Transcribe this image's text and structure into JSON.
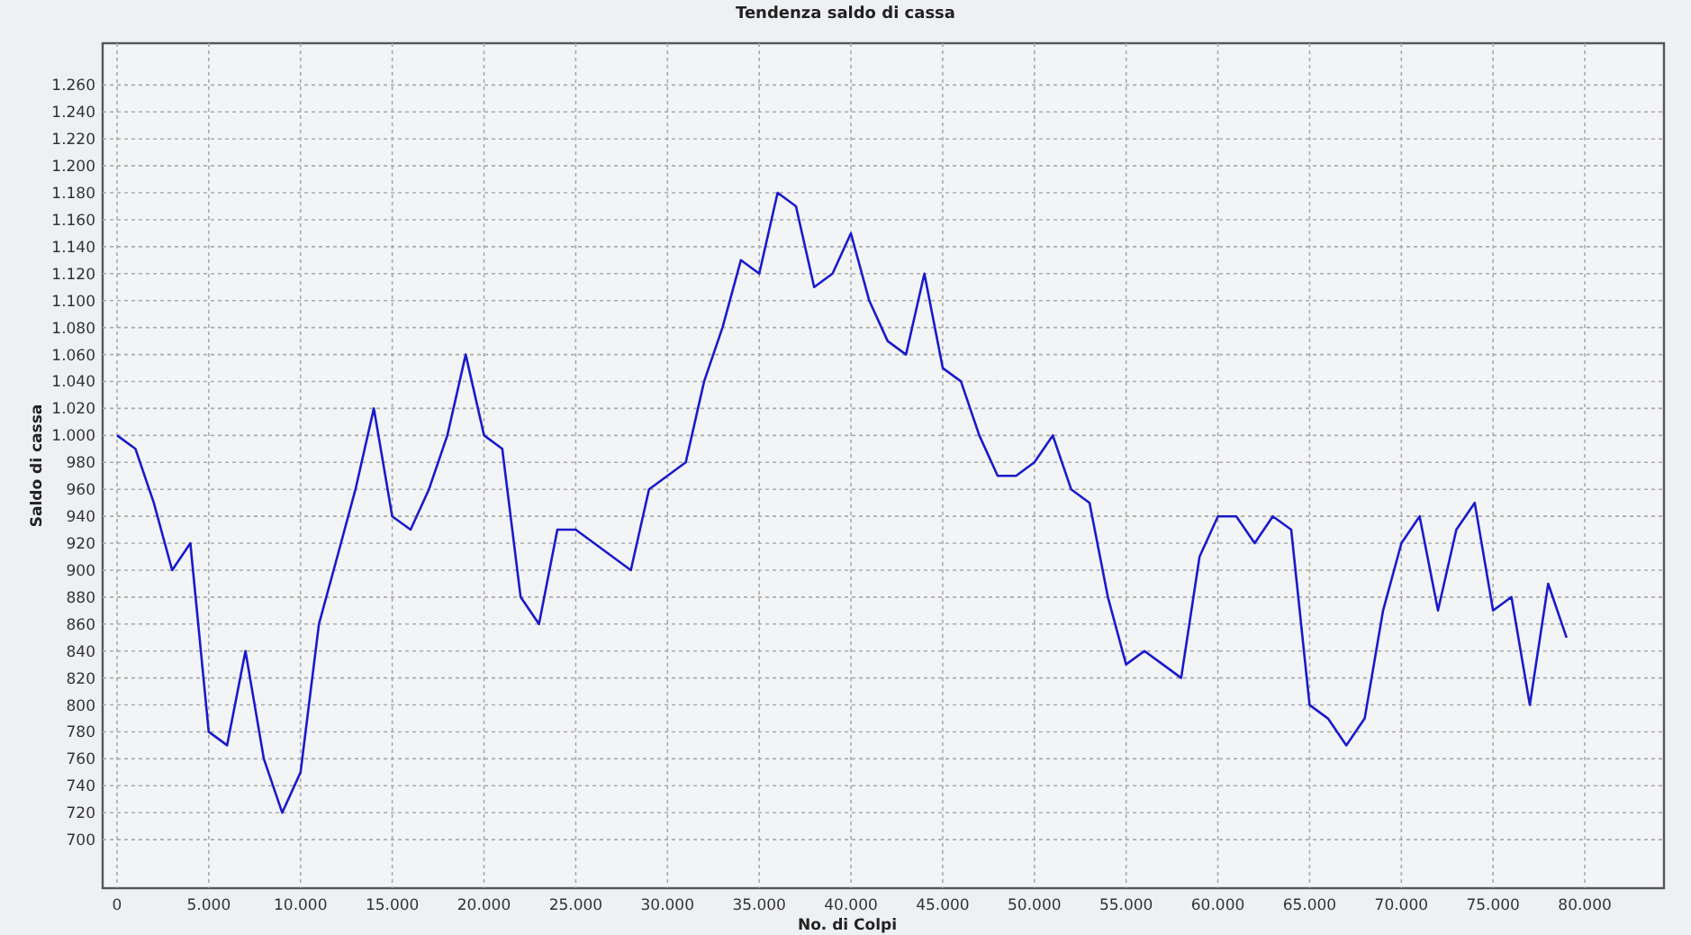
{
  "chart_data": {
    "type": "line",
    "title": "Tendenza saldo di cassa",
    "xlabel": "No. di Colpi",
    "ylabel": "Saldo di cassa",
    "x": [
      0,
      1000,
      2000,
      3000,
      4000,
      5000,
      6000,
      7000,
      8000,
      9000,
      10000,
      11000,
      12000,
      13000,
      14000,
      15000,
      16000,
      17000,
      18000,
      19000,
      20000,
      21000,
      22000,
      23000,
      24000,
      25000,
      26000,
      27000,
      28000,
      29000,
      30000,
      31000,
      32000,
      33000,
      34000,
      35000,
      36000,
      37000,
      38000,
      39000,
      40000,
      41000,
      42000,
      43000,
      44000,
      45000,
      46000,
      47000,
      48000,
      49000,
      50000,
      51000,
      52000,
      53000,
      54000,
      55000,
      56000,
      57000,
      58000,
      59000,
      60000,
      61000,
      62000,
      63000,
      64000,
      65000,
      66000,
      67000,
      68000,
      69000,
      70000,
      71000,
      72000,
      73000,
      74000,
      75000,
      76000,
      77000,
      78000,
      79000
    ],
    "series": [
      {
        "color": "#1a1acc",
        "values": [
          1000,
          990,
          950,
          900,
          920,
          780,
          770,
          840,
          760,
          720,
          750,
          860,
          910,
          960,
          1020,
          940,
          930,
          960,
          1000,
          1060,
          1000,
          990,
          880,
          860,
          930,
          930,
          920,
          910,
          900,
          960,
          970,
          980,
          1040,
          1080,
          1130,
          1120,
          1180,
          1170,
          1110,
          1120,
          1150,
          1100,
          1070,
          1060,
          1120,
          1050,
          1040,
          1000,
          970,
          970,
          980,
          1000,
          960,
          950,
          880,
          830,
          840,
          830,
          820,
          910,
          940,
          940,
          920,
          940,
          930,
          800,
          790,
          770,
          790,
          870,
          920,
          940,
          870,
          930,
          950,
          870,
          880,
          800,
          890,
          850
        ]
      }
    ],
    "xlim": [
      -785,
      84315
    ],
    "ylim": [
      664,
      1291
    ],
    "grid": true,
    "xticks": [
      {
        "value": 0,
        "label": "0"
      },
      {
        "value": 5000,
        "label": "5.000"
      },
      {
        "value": 10000,
        "label": "10.000"
      },
      {
        "value": 15000,
        "label": "15.000"
      },
      {
        "value": 20000,
        "label": "20.000"
      },
      {
        "value": 25000,
        "label": "25.000"
      },
      {
        "value": 30000,
        "label": "30.000"
      },
      {
        "value": 35000,
        "label": "35.000"
      },
      {
        "value": 40000,
        "label": "40.000"
      },
      {
        "value": 45000,
        "label": "45.000"
      },
      {
        "value": 50000,
        "label": "50.000"
      },
      {
        "value": 55000,
        "label": "55.000"
      },
      {
        "value": 60000,
        "label": "60.000"
      },
      {
        "value": 65000,
        "label": "65.000"
      },
      {
        "value": 70000,
        "label": "70.000"
      },
      {
        "value": 75000,
        "label": "75.000"
      },
      {
        "value": 80000,
        "label": "80.000"
      }
    ],
    "yticks": [
      700,
      720,
      740,
      760,
      780,
      800,
      820,
      840,
      860,
      880,
      900,
      920,
      940,
      960,
      980,
      {
        "value": 1000,
        "label": "1.000"
      },
      {
        "value": 1020,
        "label": "1.020"
      },
      {
        "value": 1040,
        "label": "1.040"
      },
      {
        "value": 1060,
        "label": "1.060"
      },
      {
        "value": 1080,
        "label": "1.080"
      },
      {
        "value": 1100,
        "label": "1.100"
      },
      {
        "value": 1120,
        "label": "1.120"
      },
      {
        "value": 1140,
        "label": "1.140"
      },
      {
        "value": 1160,
        "label": "1.160"
      },
      {
        "value": 1180,
        "label": "1.180"
      },
      {
        "value": 1200,
        "label": "1.200"
      },
      {
        "value": 1220,
        "label": "1.220"
      },
      {
        "value": 1240,
        "label": "1.240"
      },
      {
        "value": 1260,
        "label": "1.260"
      }
    ]
  }
}
